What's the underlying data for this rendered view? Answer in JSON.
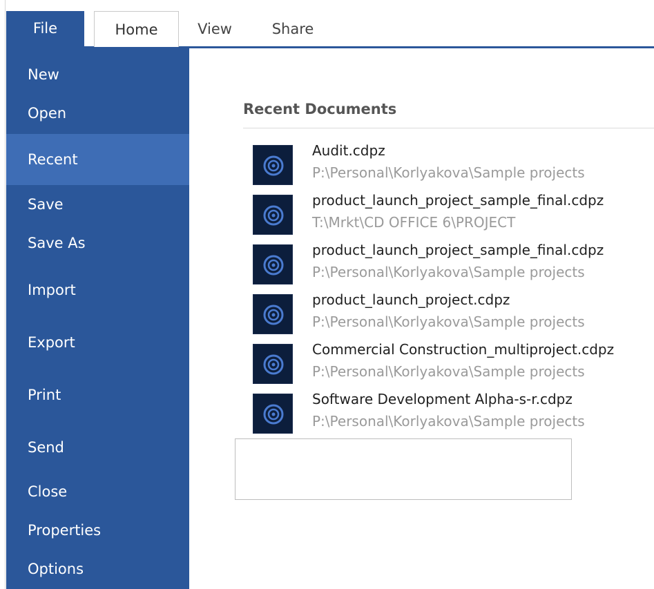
{
  "tabs": {
    "file": "File",
    "home": "Home",
    "view": "View",
    "share": "Share"
  },
  "sidebar": {
    "items": [
      {
        "label": "New"
      },
      {
        "label": "Open"
      },
      {
        "label": "Recent",
        "active": true
      },
      {
        "label": "Save"
      },
      {
        "label": "Save As"
      },
      {
        "label": "Import"
      },
      {
        "label": "Export"
      },
      {
        "label": "Print"
      },
      {
        "label": "Send"
      },
      {
        "label": "Close"
      },
      {
        "label": "Properties"
      },
      {
        "label": "Options"
      }
    ]
  },
  "main": {
    "title": "Recent Documents",
    "documents": [
      {
        "name": "Audit.cdpz",
        "path": "P:\\Personal\\Korlyakova\\Sample projects",
        "icon": "project-file-icon"
      },
      {
        "name": "product_launch_project_sample_final.cdpz",
        "path": "T:\\Mrkt\\CD OFFICE 6\\PROJECT",
        "icon": "project-file-icon"
      },
      {
        "name": "product_launch_project_sample_final.cdpz",
        "path": "P:\\Personal\\Korlyakova\\Sample projects",
        "icon": "project-file-icon"
      },
      {
        "name": "product_launch_project.cdpz",
        "path": "P:\\Personal\\Korlyakova\\Sample projects",
        "icon": "project-file-icon"
      },
      {
        "name": "Commercial Construction_multiproject.cdpz",
        "path": "P:\\Personal\\Korlyakova\\Sample projects",
        "icon": "project-file-icon"
      },
      {
        "name": "Software Development Alpha-s-r.cdpz",
        "path": "P:\\Personal\\Korlyakova\\Sample projects",
        "icon": "project-file-icon"
      }
    ]
  },
  "colors": {
    "accent": "#2b579a",
    "active_item": "#3e6db5",
    "icon_bg": "#0c1e3c",
    "icon_ring": "#4a7bd0",
    "path_text": "#9a9a9a"
  }
}
